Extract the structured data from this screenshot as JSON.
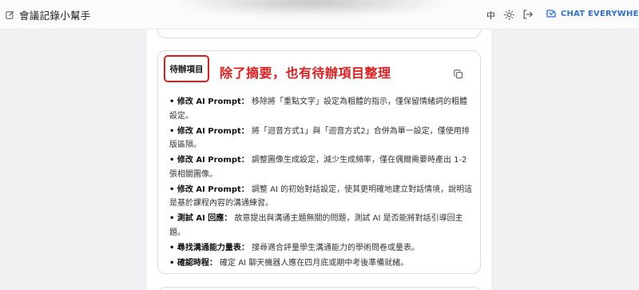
{
  "header": {
    "title": "會議記錄小幫手",
    "lang_label": "中",
    "brand_text": "CHAT EVERYWHERE",
    "brand_color": "#2f6fd6",
    "icons": [
      "edit-icon",
      "sun-icon",
      "logout-icon",
      "brand-logo-icon"
    ]
  },
  "card": {
    "tag_label": "待辦項目",
    "annotation": "除了摘要，也有待辦項目整理",
    "annotation_color": "#e11d1d",
    "items": [
      {
        "bullet": "• ",
        "key": "修改 AI Prompt：",
        "text": " 移除將「重點文字」設定為粗體的指示，僅保留情緒詞的粗體設定。"
      },
      {
        "bullet": "• ",
        "key": "修改 AI Prompt：",
        "text": " 將「迴音方式1」與「迴音方式2」合併為單一設定，僅使用排版區隔。"
      },
      {
        "bullet": "• ",
        "key": "修改 AI Prompt：",
        "text": " 調整圖像生成設定，減少生成頻率，僅在偶爾需要時產出 1-2 張相關圖像。"
      },
      {
        "bullet": "• ",
        "key": "修改 AI Prompt：",
        "text": " 調整 AI 的初始對話設定，使其更明確地建立對話情境，說明這是基於課程內容的溝通練習。"
      },
      {
        "bullet": "• ",
        "key": "測試 AI 回應：",
        "text": " 故意提出與溝通主題無關的問題，測試 AI 是否能將對話引導回主題。"
      },
      {
        "bullet": "• ",
        "key": "尋找溝通能力量表：",
        "text": " 搜尋適合評量學生溝通能力的學術問卷或量表。"
      },
      {
        "bullet": "• ",
        "key": "確認時程：",
        "text": " 確定 AI 聊天機器人應在四月底或期中考後準備就緒。"
      }
    ]
  }
}
